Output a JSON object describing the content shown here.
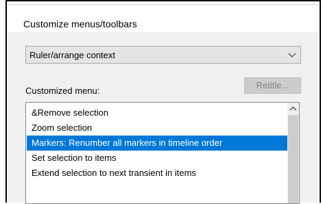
{
  "dialog": {
    "title": "Customize menus/toolbars",
    "context_dropdown": {
      "selected": "Ruler/arrange context",
      "arrow_icon": "chevron-down-icon"
    },
    "customized_menu_label": "Customized menu:",
    "retitle_button": {
      "label": "Retitle...",
      "enabled": false
    },
    "menu_items": [
      {
        "label": "&Remove selection",
        "selected": false
      },
      {
        "label": "Zoom selection",
        "selected": false
      },
      {
        "label": "Markers: Renumber all markers in timeline order",
        "selected": true
      },
      {
        "label": "Set selection to items",
        "selected": false
      },
      {
        "label": "Extend selection to next transient in items",
        "selected": false
      }
    ],
    "scrollbar": {
      "up_arrow_icon": "chevron-up-icon"
    }
  },
  "colors": {
    "selection": "#0078d7",
    "client_background": "#f0f0f0",
    "disabled_text": "#838383"
  }
}
